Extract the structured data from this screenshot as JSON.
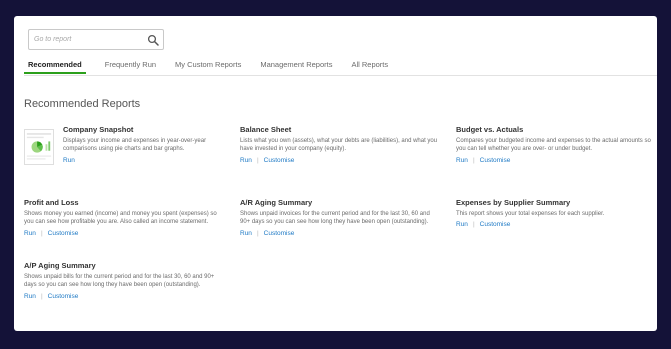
{
  "search": {
    "placeholder": "Go to report"
  },
  "tabs": [
    {
      "label": "Recommended",
      "active": true
    },
    {
      "label": "Frequently Run"
    },
    {
      "label": "My Custom Reports"
    },
    {
      "label": "Management Reports"
    },
    {
      "label": "All Reports"
    }
  ],
  "section_title": "Recommended Reports",
  "reports": {
    "company_snapshot": {
      "title": "Company Snapshot",
      "description": "Displays your income and expenses in year-over-year comparisons using pie charts and bar graphs.",
      "run": "Run"
    },
    "balance_sheet": {
      "title": "Balance Sheet",
      "description": "Lists what you own (assets), what your debts are (liabilities), and what you have invested in your company (equity).",
      "run": "Run",
      "customise": "Customise"
    },
    "budget_vs_actuals": {
      "title": "Budget vs. Actuals",
      "description": "Compares your budgeted income and expenses to the actual amounts so you can tell whether you are over- or under budget.",
      "run": "Run",
      "customise": "Customise"
    },
    "profit_and_loss": {
      "title": "Profit and Loss",
      "description": "Shows money you earned (income) and money you spent (expenses) so you can see how profitable you are. Also called an income statement.",
      "run": "Run",
      "customise": "Customise"
    },
    "ar_aging_summary": {
      "title": "A/R Aging Summary",
      "description": "Shows unpaid invoices for the current period and for the last 30, 60 and 90+ days so you can see how long they have been open (outstanding).",
      "run": "Run",
      "customise": "Customise"
    },
    "expenses_by_supplier": {
      "title": "Expenses by Supplier Summary",
      "description": "This report shows your total expenses for each supplier.",
      "run": "Run",
      "customise": "Customise"
    },
    "ap_aging_summary": {
      "title": "A/P Aging Summary",
      "description": "Shows unpaid bills for the current period and for the last 30, 60 and 90+ days so you can see how long they have been open (outstanding).",
      "run": "Run",
      "customise": "Customise"
    }
  },
  "colors": {
    "accent": "#2ca01c",
    "link": "#1f7ac5",
    "frame_bg": "#141238"
  },
  "icons": {
    "search": "search-icon"
  }
}
